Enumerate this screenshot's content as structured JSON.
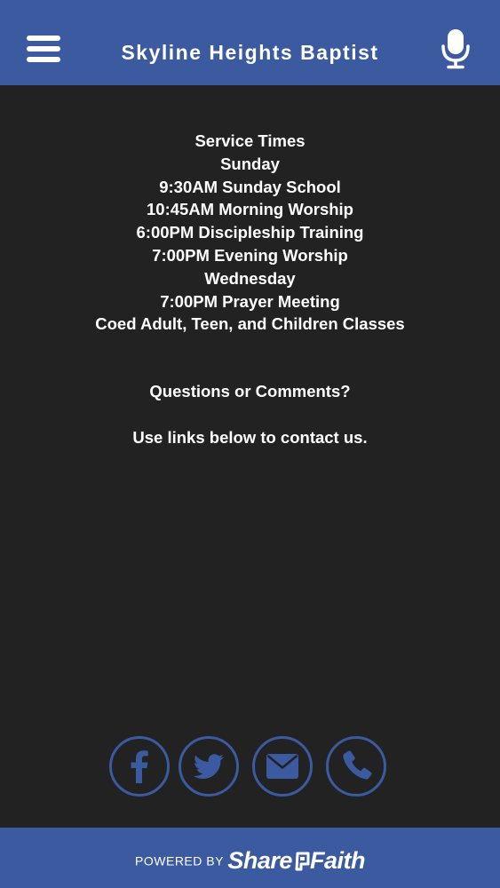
{
  "header": {
    "title": "Skyline Heights Baptist",
    "menu_icon": "hamburger-menu-icon",
    "mic_icon": "microphone-icon",
    "bar_color": "#3b5aa0"
  },
  "service": {
    "heading": "Service Times",
    "sunday_label": "Sunday",
    "sunday_times": [
      "9:30AM Sunday School",
      "10:45AM Morning Worship",
      "6:00PM Discipleship Training",
      "7:00PM Evening Worship"
    ],
    "wednesday_label": "Wednesday",
    "wednesday_times": [
      "7:00PM Prayer Meeting"
    ],
    "classes": "Coed Adult, Teen, and Children Classes"
  },
  "contact": {
    "question": "Questions or Comments?",
    "instruction": "Use links below to contact us."
  },
  "social": [
    {
      "icon": "facebook-icon"
    },
    {
      "icon": "twitter-icon"
    },
    {
      "icon": "email-icon"
    },
    {
      "icon": "phone-icon"
    }
  ],
  "footer": {
    "powered_by": "POWERED BY",
    "brand_part1": "Share",
    "brand_part2": "Faith"
  },
  "colors": {
    "background": "#222222",
    "accent": "#3b5aa0",
    "text": "#ffffff"
  }
}
